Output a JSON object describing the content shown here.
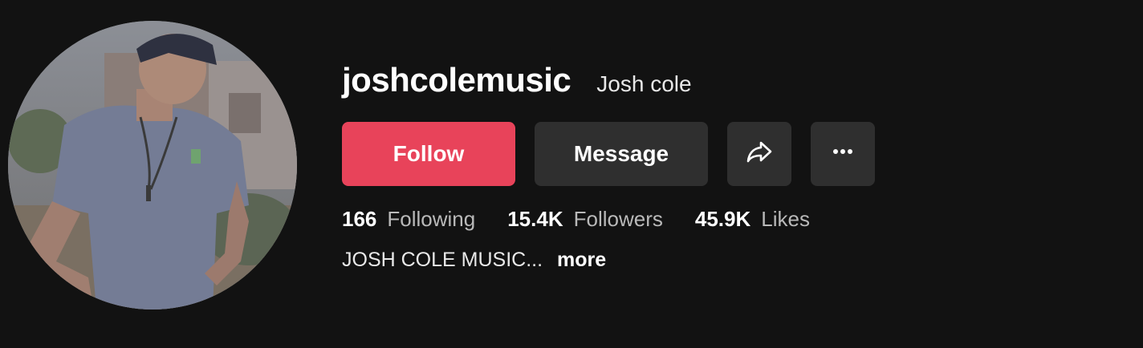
{
  "profile": {
    "username": "joshcolemusic",
    "nickname": "Josh cole"
  },
  "actions": {
    "follow_label": "Follow",
    "message_label": "Message",
    "share_icon": "share-arrow-icon",
    "more_icon": "ellipsis-icon"
  },
  "stats": {
    "following": {
      "count": "166",
      "label": "Following"
    },
    "followers": {
      "count": "15.4K",
      "label": "Followers"
    },
    "likes": {
      "count": "45.9K",
      "label": "Likes"
    }
  },
  "bio": {
    "text": "JOSH COLE MUSIC...",
    "more_label": "more"
  },
  "colors": {
    "background": "#121212",
    "follow_button": "#e8435a",
    "secondary_button": "#2f2f2f"
  }
}
